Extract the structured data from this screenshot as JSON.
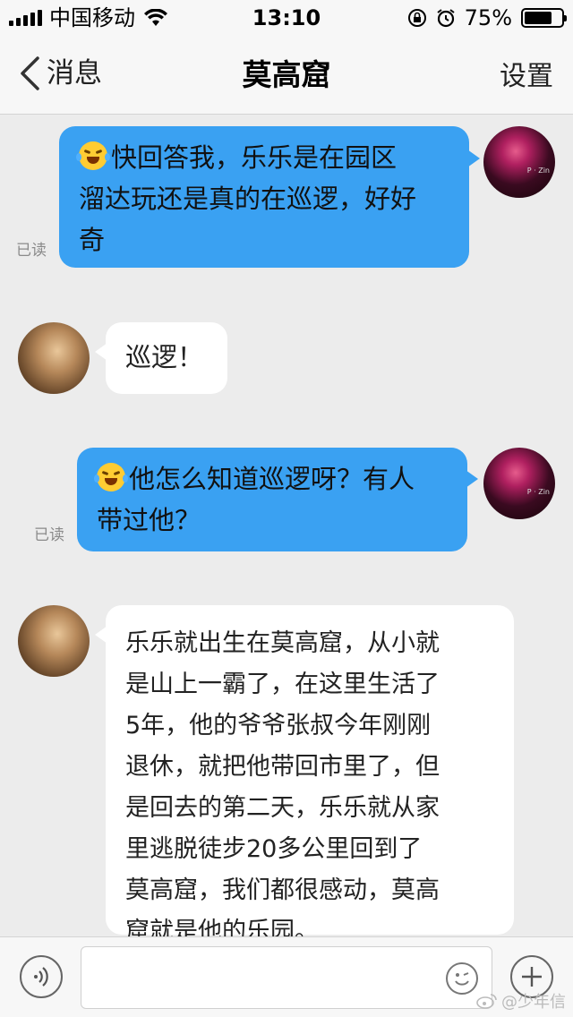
{
  "status_bar": {
    "carrier": "中国移动",
    "time": "13:10",
    "battery_percent": "75%",
    "battery_level": 0.75
  },
  "nav": {
    "back_label": "消息",
    "title": "莫高窟",
    "settings_label": "设置"
  },
  "messages": [
    {
      "from": "me",
      "text": "快回答我，乐乐是在园区溜达玩还是真的在巡逻，好好奇",
      "lines": [
        "快回答我，乐乐是在园区",
        "溜达玩还是真的在巡逻，好好",
        "奇"
      ],
      "read_label": "已读",
      "emoji": "laugh-cry-emoji"
    },
    {
      "from": "them",
      "text": "巡逻！",
      "lines": [
        "巡逻！"
      ]
    },
    {
      "from": "me",
      "text": "他怎么知道巡逻呀？有人带过他？",
      "lines": [
        "他怎么知道巡逻呀？有人",
        "带过他？"
      ],
      "read_label": "已读",
      "emoji": "laugh-cry-emoji"
    },
    {
      "from": "them",
      "text": "乐乐就出生在莫高窟，从小就是山上一霸了，在这里生活了5年，他的爷爷张叔今年刚刚退休，就把他带回市里了，但是回去的第二天，乐乐就从家里逃脱徒步20多公里回到了莫高窟，我们都很感动，莫高窟就是他的乐园。",
      "lines": [
        "乐乐就出生在莫高窟，从小就",
        "是山上一霸了，在这里生活了",
        "5年，他的爷爷张叔今年刚刚",
        "退休，就把他带回市里了，但",
        "是回去的第二天，乐乐就从家",
        "里逃脱徒步20多公里回到了",
        "莫高窟，我们都很感动，莫高",
        "窟就是他的乐园。"
      ]
    }
  ],
  "input": {
    "value": "",
    "placeholder": ""
  },
  "watermark": "@少年信",
  "colors": {
    "outgoing_bubble": "#3aa1f2",
    "incoming_bubble": "#ffffff",
    "background": "#ececec"
  }
}
